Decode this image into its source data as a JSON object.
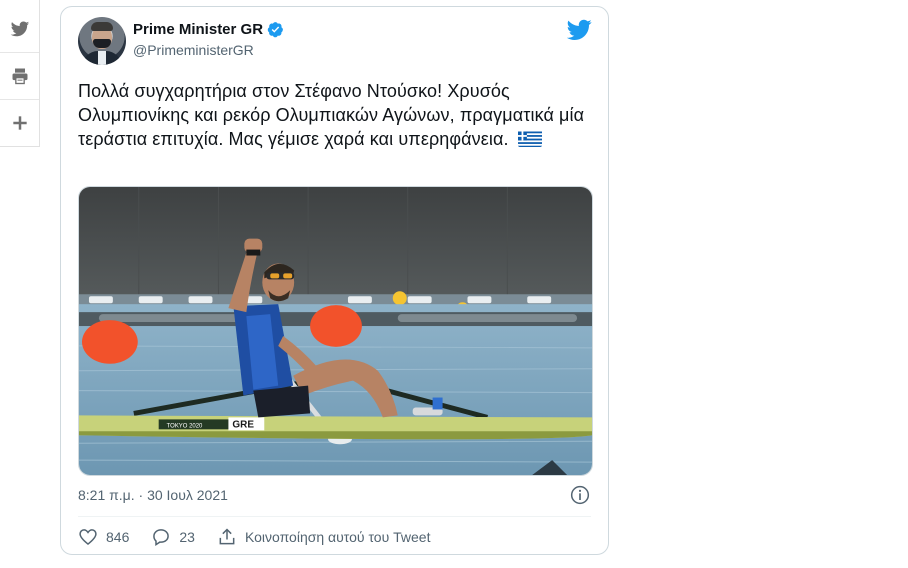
{
  "share_rail": {
    "items": [
      {
        "icon": "twitter-icon"
      },
      {
        "icon": "print-icon"
      },
      {
        "icon": "plus-icon"
      }
    ]
  },
  "tweet": {
    "display_name": "Prime Minister GR",
    "handle": "@PrimeministerGR",
    "text": "Πολλά συγχαρητήρια στον Στέφανο Ντούσκο! Χρυσός Ολυμπιονίκης και ρεκόρ Ολυμπιακών Αγώνων, πραγματικά μία τεράστια επιτυχία. Μας γέμισε χαρά και υπερηφάνεια.",
    "timestamp": "8:21 π.μ. · 30 Ιουλ 2021",
    "media": {
      "boat_label": "GRE",
      "boat_sponsor": "TOKYO 2020"
    },
    "actions": {
      "likes": "846",
      "replies": "23",
      "share_label": "Κοινοποίηση αυτού του Tweet"
    },
    "colors": {
      "accent": "#1d9bf0",
      "text": "#0f1419",
      "secondary": "#536471",
      "border": "#cfd9de"
    }
  }
}
